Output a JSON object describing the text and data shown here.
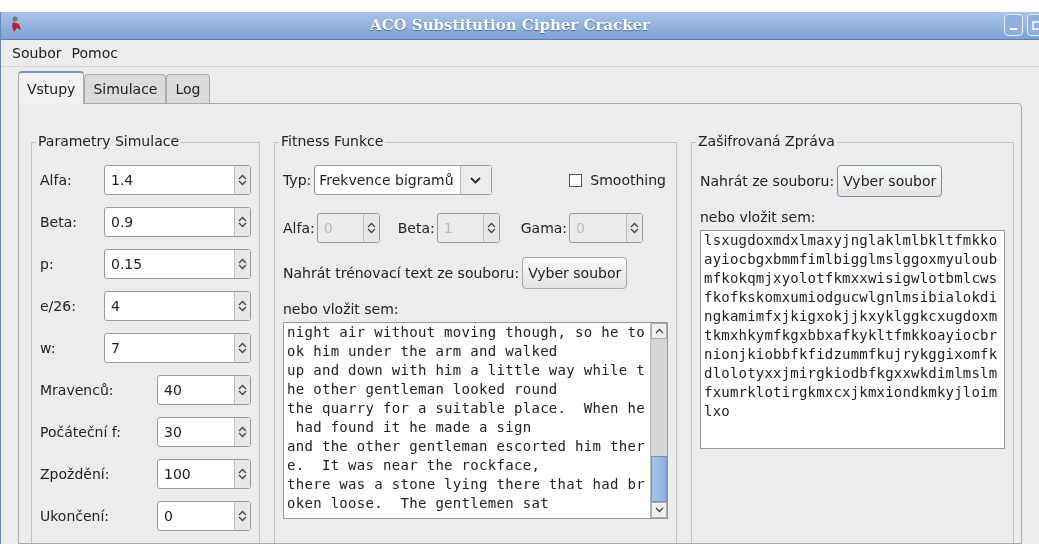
{
  "window": {
    "title": "ACO Substitution Cipher Cracker"
  },
  "menu": [
    "Soubor",
    "Pomoc"
  ],
  "tabs": [
    {
      "label": "Vstupy",
      "selected": true
    },
    {
      "label": "Simulace",
      "selected": false
    },
    {
      "label": "Log",
      "selected": false
    }
  ],
  "parameters": {
    "title": "Parametry Simulace",
    "fields": [
      {
        "label": "Alfa:",
        "value": "1.4"
      },
      {
        "label": "Beta:",
        "value": "0.9"
      },
      {
        "label": "p:",
        "value": "0.15"
      },
      {
        "label": "e/26:",
        "value": "4"
      },
      {
        "label": "w:",
        "value": "7"
      },
      {
        "label": "Mravenců:",
        "value": "40"
      },
      {
        "label": "Počáteční f:",
        "value": "30"
      },
      {
        "label": "Zpoždění:",
        "value": "100"
      },
      {
        "label": "Ukončení:",
        "value": "0"
      }
    ]
  },
  "fitness": {
    "title": "Fitness Funkce",
    "type_label": "Typ:",
    "type_value": "Frekvence bigramů",
    "smoothing": {
      "label": "Smoothing",
      "checked": false
    },
    "coefficients": [
      {
        "label": "Alfa:",
        "value": "0",
        "disabled": true
      },
      {
        "label": "Beta:",
        "value": "1",
        "disabled": true
      },
      {
        "label": "Gama:",
        "value": "0",
        "disabled": true
      }
    ],
    "load_label": "Nahrát trénovací text ze souboru:",
    "load_button": "Vyber soubor",
    "paste_label": "nebo vložit sem:",
    "text_lines": [
      "night air without moving though, so he to",
      "ok him under the arm and walked",
      "up and down with him a little way while t",
      "he other gentleman looked round",
      "the quarry for a suitable place.  When he",
      " had found it he made a sign",
      "and the other gentleman escorted him ther",
      "e.  It was near the rockface,",
      "there was a stone lying there that had br",
      "oken loose.  The gentlemen sat"
    ]
  },
  "cipher": {
    "title": "Zašifrovaná Zpráva",
    "load_label": "Nahrát ze souboru:",
    "load_button": "Vyber soubor",
    "paste_label": "nebo vložit sem:",
    "text_lines": [
      "lsxugdoxmdxlmaxyjnglaklmlbkltfmkko",
      "ayiocbgxbmmfimlbigglmslggoxmyuloub",
      "mfkokqmjxyolotfkmxxwisigwlotbmlcws",
      "fkofkskomxumiodgucwlgnlmsibialokdi",
      "ngkamimfxjkigxokjjkxyklggkcxugdoxm",
      "tkmxhkymfkgxbbxafkykltfmkkoayiocbr",
      "nionjkiobbfkfidzummfkujrykggixomfk",
      "dlolotyxxjmirgkiodbfkgxxwkdimlmslm",
      "fxumrklotirgkmxcxjkmxiondkmkyjloim",
      "lxo"
    ]
  }
}
